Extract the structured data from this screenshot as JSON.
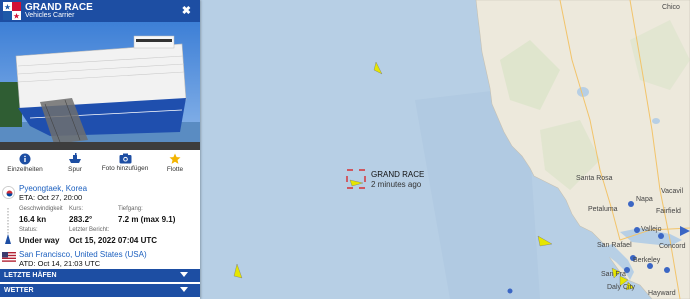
{
  "vessel": {
    "name": "GRAND RACE",
    "type": "Vehicles Carrier",
    "flag_colors": [
      "#1d59a8",
      "#d21034",
      "#ffffff"
    ]
  },
  "actions": [
    {
      "label": "Einzelheiten",
      "icon": "info-icon"
    },
    {
      "label": "Spur",
      "icon": "track-icon"
    },
    {
      "label": "Foto hinzufügen",
      "icon": "camera-icon"
    },
    {
      "label": "Flotte",
      "icon": "star-icon"
    }
  ],
  "destination": {
    "port": "Pyeongtaek, Korea",
    "eta": "ETA: Oct 27, 20:00"
  },
  "info": {
    "speed_label": "Geschwindigkeit",
    "speed_value": "16.4 kn",
    "course_label": "Kurs:",
    "course_value": "283.2°",
    "draught_label": "Tiefgang:",
    "draught_value": "7.2 m (max 9.1)",
    "status_label": "Status:",
    "status_value": "Under way",
    "report_label": "Letzter Bericht:",
    "report_value": "Oct 15, 2022 07:04 UTC"
  },
  "origin": {
    "port": "San Francisco, United States (USA)",
    "atd": "ATD: Oct 14, 21:03 UTC"
  },
  "sections": [
    {
      "label": "LETZTE HÄFEN"
    },
    {
      "label": "WETTER"
    }
  ],
  "map": {
    "selected_ship_name": "GRAND RACE",
    "selected_ship_age": "2 minutes ago",
    "place_labels": [
      "Chico",
      "Santa Rosa",
      "Napa",
      "Fairfield",
      "Vacavil",
      "Petaluma",
      "Vallejo",
      "San Rafael",
      "Concord",
      "Berkeley",
      "San Fra",
      "Daly City",
      "Hayward"
    ],
    "ocean_color": "#b7cfe5",
    "land_color": "#ede9dc",
    "accent_color": "#1d4ea3"
  }
}
